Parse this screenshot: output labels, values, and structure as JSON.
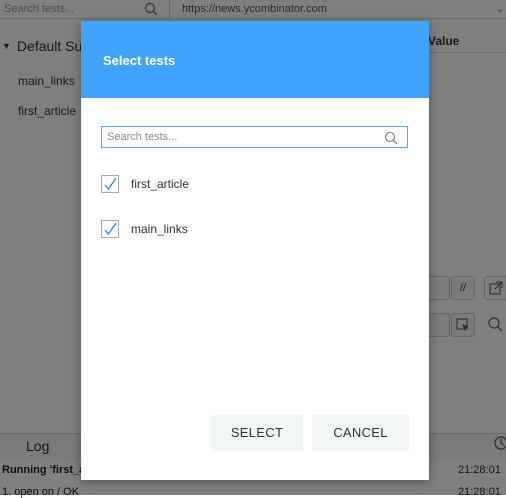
{
  "background": {
    "search_placeholder": "Search tests...",
    "url": "https://news.ycombinator.com",
    "tree_root": "Default Suite",
    "tree_items": [
      "main_links",
      "first_article"
    ],
    "column_header": "Value",
    "tool_labels": [
      "//"
    ],
    "log_tab": "Log",
    "log_rows": [
      {
        "text": "Running 'first_article'",
        "time": "21:28:01"
      },
      {
        "text": "1.  open on / OK",
        "time": "21:28:01"
      }
    ]
  },
  "modal": {
    "title": "Select tests",
    "search_placeholder": "Search tests...",
    "search_value": "",
    "tests": [
      {
        "label": "first_article",
        "checked": true
      },
      {
        "label": "main_links",
        "checked": true
      }
    ],
    "select_button": "SELECT",
    "cancel_button": "CANCEL"
  },
  "colors": {
    "header": "#40a3ff",
    "accent": "#58a9e8",
    "button_bg": "#f2f6f6",
    "check": "#2f86d8"
  }
}
